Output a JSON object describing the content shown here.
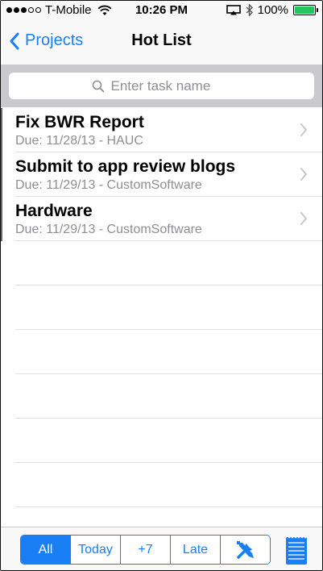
{
  "status": {
    "carrier": "T-Mobile",
    "time": "10:26 PM",
    "battery": "100%",
    "battery_level": 1.0,
    "signal_bars_filled": 3
  },
  "nav": {
    "back_label": "Projects",
    "title": "Hot List"
  },
  "search": {
    "placeholder": "Enter task name"
  },
  "tasks": [
    {
      "title": "Fix BWR Report",
      "due": "Due: 11/28/13 - HAUC"
    },
    {
      "title": "Submit to app review blogs",
      "due": "Due: 11/29/13 - CustomSoftware"
    },
    {
      "title": "Hardware",
      "due": "Due: 11/29/13 - CustomSoftware"
    }
  ],
  "filters": {
    "all": "All",
    "today": "Today",
    "week": "+7",
    "late": "Late",
    "tools_icon": "tools-icon"
  },
  "colors": {
    "accent": "#1a7ef5",
    "battery": "#22c55e"
  }
}
